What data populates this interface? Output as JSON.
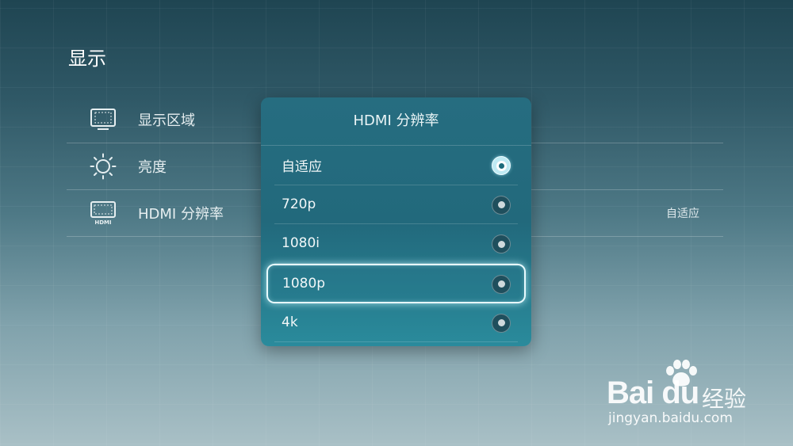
{
  "page": {
    "title": "显示"
  },
  "menu": {
    "items": [
      {
        "label": "显示区域",
        "icon": "display-area-icon",
        "value": ""
      },
      {
        "label": "亮度",
        "icon": "brightness-sun-icon",
        "value": ""
      },
      {
        "label": "HDMI 分辨率",
        "icon": "hdmi-icon",
        "value": "自适应"
      }
    ]
  },
  "dialog": {
    "title": "HDMI 分辨率",
    "options": [
      {
        "label": "自适应",
        "selected": true,
        "focused": false
      },
      {
        "label": "720p",
        "selected": false,
        "focused": false
      },
      {
        "label": "1080i",
        "selected": false,
        "focused": false
      },
      {
        "label": "1080p",
        "selected": false,
        "focused": true
      },
      {
        "label": "4k",
        "selected": false,
        "focused": false
      }
    ]
  },
  "watermark": {
    "logo": "Bai du",
    "brand_cn": "经验",
    "url": "jingyan.baidu.com"
  },
  "colors": {
    "dialog_bg": "#236c7f",
    "focus_ring": "#e8fbff",
    "selected_radio": "#bfeaf3"
  }
}
